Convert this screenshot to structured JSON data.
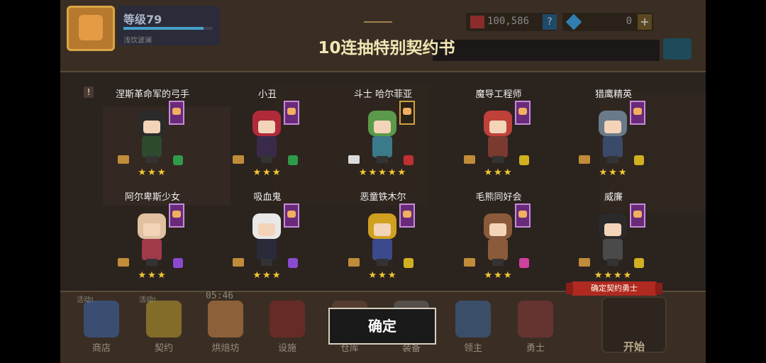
{
  "hud": {
    "level": "等级79",
    "player_name": "浅饮波澜",
    "level_progress": 0.9,
    "gold": "100,586",
    "gems": "0",
    "help_label": "?",
    "plus_label": "+"
  },
  "dialog": {
    "title": "10连抽特别契约书",
    "confirm_label": "确定",
    "recommend_label": "确定契约勇士",
    "excl_label": "!",
    "heroes": [
      {
        "name": "涅斯革命军的弓手",
        "stars": "★★★",
        "hair": "#2b2b2b",
        "body": "#2d4a2d",
        "weapon": "#2f9a4a",
        "scroll": "gold"
      },
      {
        "name": "小丑",
        "stars": "★★★",
        "hair": "#b02a3a",
        "body": "#3a2a4a",
        "weapon": "#2f9a4a",
        "scroll": "gold"
      },
      {
        "name": "斗士 哈尔菲亚",
        "stars": "★★★★★",
        "hair": "#5a9a4a",
        "body": "#3a7a8a",
        "weapon": "#c03030",
        "scroll": "white",
        "banner": "gold"
      },
      {
        "name": "魔导工程师",
        "stars": "★★★",
        "hair": "#c0403a",
        "body": "#7a3a30",
        "weapon": "#d0b020",
        "scroll": "gold"
      },
      {
        "name": "猎鹰精英",
        "stars": "★★★",
        "hair": "#6a7a8a",
        "body": "#3a4a6a",
        "weapon": "#d0b020",
        "scroll": "gold"
      },
      {
        "name": "阿尔卑斯少女",
        "stars": "★★★",
        "hair": "#e0c0a0",
        "body": "#a03a4a",
        "weapon": "#8a4ad0",
        "scroll": "gold"
      },
      {
        "name": "吸血鬼",
        "stars": "★★★",
        "hair": "#e8e8e8",
        "body": "#2a2a3a",
        "weapon": "#8a4ad0",
        "scroll": "gold"
      },
      {
        "name": "恶童铁木尔",
        "stars": "★★★",
        "hair": "#d0a020",
        "body": "#3a4a8a",
        "weapon": "#d0b020",
        "scroll": "gold"
      },
      {
        "name": "毛熊同好会",
        "stars": "★★★",
        "hair": "#8a5a3a",
        "body": "#8a5a3a",
        "weapon": "#d040a0",
        "scroll": "gold"
      },
      {
        "name": "威廉",
        "stars": "★★★★",
        "hair": "#2a2a2a",
        "body": "#4a4a4a",
        "weapon": "#d0b020",
        "scroll": "gold"
      }
    ]
  },
  "dock": {
    "timer": "05:46",
    "items": [
      {
        "label": "商店",
        "tag": "活动!",
        "color": "#3a6ab0"
      },
      {
        "label": "契约",
        "tag": "活动!",
        "color": "#c0a030"
      },
      {
        "label": "烘焙坊",
        "tag": "",
        "color": "#d08a4a"
      },
      {
        "label": "设施",
        "tag": "",
        "color": "#8a2a2a"
      },
      {
        "label": "仓库",
        "tag": "",
        "color": "#6a4a3a"
      },
      {
        "label": "装备",
        "tag": "",
        "color": "#6a6a6a"
      },
      {
        "label": "领主",
        "tag": "",
        "color": "#3a6aa0"
      },
      {
        "label": "勇士",
        "tag": "",
        "color": "#8a3a3a"
      }
    ],
    "start_label": "开始"
  }
}
